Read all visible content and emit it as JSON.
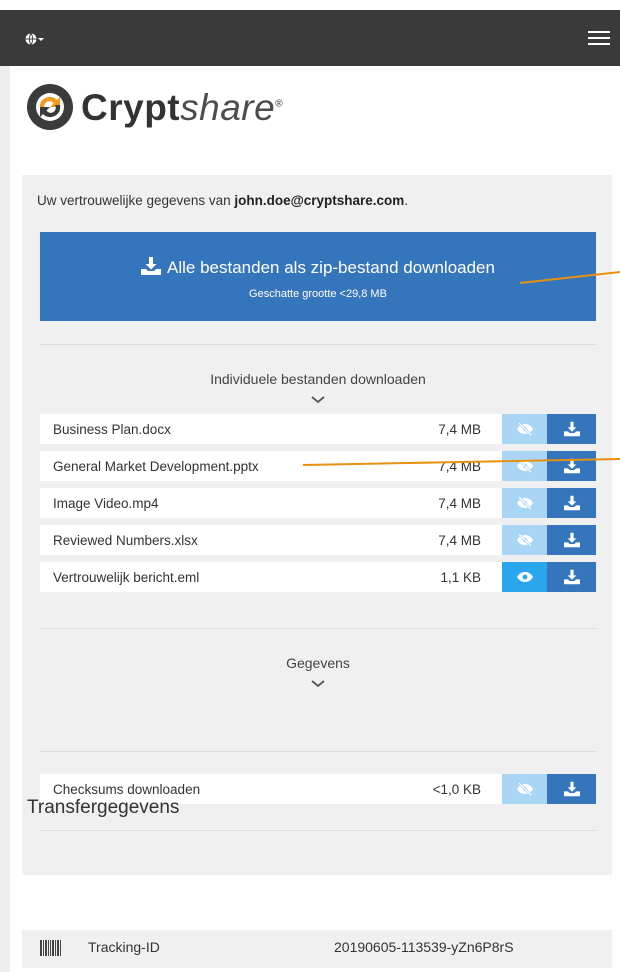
{
  "brand": {
    "name_bold": "Crypt",
    "name_italic": "share",
    "registered": "®"
  },
  "intro": {
    "prefix": "Uw vertrouwelijke gegevens van ",
    "email": "john.doe@cryptshare.com",
    "suffix": "."
  },
  "zip_download": {
    "label": "Alle bestanden als zip-bestand downloaden",
    "subtitle": "Geschatte grootte <29,8 MB"
  },
  "individual": {
    "title": "Individuele bestanden downloaden"
  },
  "files": [
    {
      "name": "Business Plan.docx",
      "size": "7,4 MB",
      "preview_enabled": false
    },
    {
      "name": "General Market Development.pptx",
      "size": "7,4 MB",
      "preview_enabled": false
    },
    {
      "name": "Image Video.mp4",
      "size": "7,4 MB",
      "preview_enabled": false
    },
    {
      "name": "Reviewed Numbers.xlsx",
      "size": "7,4 MB",
      "preview_enabled": false
    },
    {
      "name": "Vertrouwelijk bericht.eml",
      "size": "1,1 KB",
      "preview_enabled": true
    }
  ],
  "details": {
    "title": "Gegevens"
  },
  "checksums": {
    "name": "Checksums downloaden",
    "size": "<1,0 KB",
    "preview_enabled": false
  },
  "transfer": {
    "title": "Transfergegevens",
    "tracking_label": "Tracking-ID",
    "tracking_value": "20190605-113539-yZn6P8rS"
  },
  "colors": {
    "topbar": "#3a3a3a",
    "primary_blue": "#3575bb",
    "preview_disabled": "#a9d6f5",
    "preview_enabled": "#2aa6ef",
    "annotation_line": "#e8900f",
    "panel_bg": "#f0f0f0"
  },
  "icons": {
    "language": "globe-icon",
    "menu": "hamburger-icon",
    "download": "download-icon",
    "preview_disabled": "eye-slash-icon",
    "preview_enabled": "eye-icon",
    "expand": "chevron-down-icon",
    "tracking": "barcode-icon"
  }
}
